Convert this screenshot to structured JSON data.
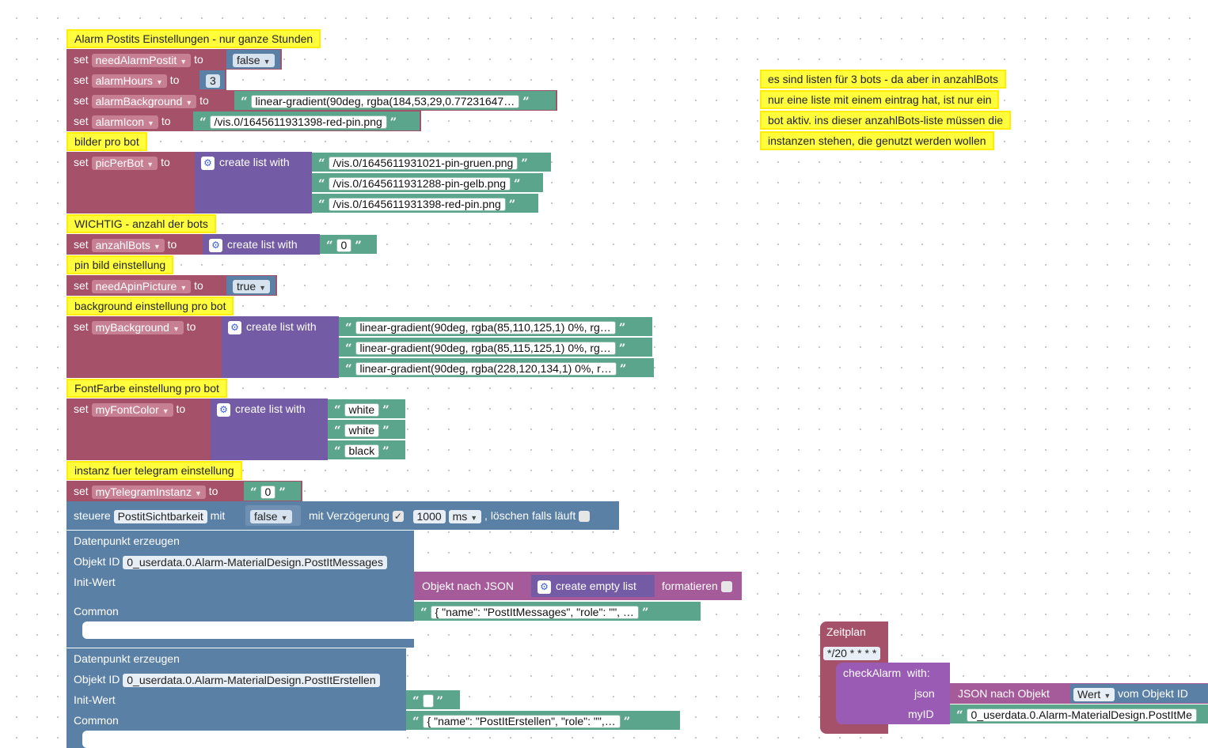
{
  "comments": {
    "c1": "Alarm Postits Einstellungen - nur ganze Stunden",
    "c2": "bilder pro bot",
    "c3": "WICHTIG - anzahl der bots",
    "c4": "pin bild einstellung",
    "c5": "background einstellung pro bot",
    "c6": "FontFarbe einstellung pro bot",
    "c7": "instanz fuer telegram einstellung",
    "side1": "es sind listen für 3 bots  - da aber in anzahlBots",
    "side2": "nur eine liste mit einem eintrag hat, ist nur ein",
    "side3": "bot aktiv. ins dieser anzahlBots-liste müssen die",
    "side4": "instanzen stehen, die genutzt werden wollen"
  },
  "kw": {
    "set": "set",
    "to": "to",
    "create_list_with": "create list with",
    "create_empty_list": "create empty list",
    "open_quote": "“",
    "close_quote": "”"
  },
  "vars": {
    "needAlarmPostit": "needAlarmPostit",
    "alarmHours": "alarmHours",
    "alarmBackground": "alarmBackground",
    "alarmIcon": "alarmIcon",
    "picPerBot": "picPerBot",
    "anzahlBots": "anzahlBots",
    "needApinPicture": "needApinPicture",
    "myBackground": "myBackground",
    "myFontColor": "myFontColor",
    "myTelegramInstanz": "myTelegramInstanz"
  },
  "values": {
    "needAlarmPostit": "false",
    "alarmHours": "3",
    "alarmBackground": "linear-gradient(90deg, rgba(184,53,29,0.77231647…",
    "alarmIcon": "/vis.0/1645611931398-red-pin.png",
    "pic1": "/vis.0/1645611931021-pin-gruen.png",
    "pic2": "/vis.0/1645611931288-pin-gelb.png",
    "pic3": "/vis.0/1645611931398-red-pin.png",
    "anzahl1": "0",
    "needApinPicture": "true",
    "bg1": "linear-gradient(90deg, rgba(85,110,125,1) 0%, rg…",
    "bg2": "linear-gradient(90deg, rgba(85,115,125,1) 0%, rg…",
    "bg3": "linear-gradient(90deg, rgba(228,120,134,1) 0%, r…",
    "font1": "white",
    "font2": "white",
    "font3": "black",
    "telegram": "0"
  },
  "steuere": {
    "label": "steuere",
    "object": "PostitSichtbarkeit",
    "mit": "mit",
    "value": "false",
    "delay_label": "mit Verzögerung",
    "delay_checked": "✓",
    "delay_value": "1000",
    "unit": "ms",
    "clear_label": ", löschen falls läuft"
  },
  "dp1": {
    "title": "Datenpunkt erzeugen",
    "objid_label": "Objekt ID",
    "objid": "0_userdata.0.Alarm-MaterialDesign.PostItMessages",
    "init_label": "Init-Wert",
    "common_label": "Common",
    "tojson_label": "Objekt nach JSON",
    "format_label": "formatieren",
    "common_value": "{     \"name\": \"PostItMessages\",     \"role\": \"\", …"
  },
  "dp2": {
    "title": "Datenpunkt erzeugen",
    "objid_label": "Objekt ID",
    "objid": "0_userdata.0.Alarm-MaterialDesign.PostItErstellen",
    "init_label": "Init-Wert",
    "init_value": "",
    "common_label": "Common",
    "common_value": "{     \"name\": \"PostItErstellen\",     \"role\": \"\",…"
  },
  "schedule": {
    "label": "Zeitplan",
    "cron": "*/20 * * * *",
    "call": "checkAlarm",
    "with": "with:",
    "arg1": "json",
    "arg2": "myID",
    "json_to_obj": "JSON nach Objekt",
    "wert": "Wert",
    "vom": "vom Objekt ID",
    "id_value": "0_userdata.0.Alarm-MaterialDesign.PostItMe"
  },
  "colors": {
    "variables": "#a5516a",
    "lists": "#745ba5",
    "text": "#5ba58c",
    "control": "#5b80a5",
    "comment": "#fffd3c"
  }
}
